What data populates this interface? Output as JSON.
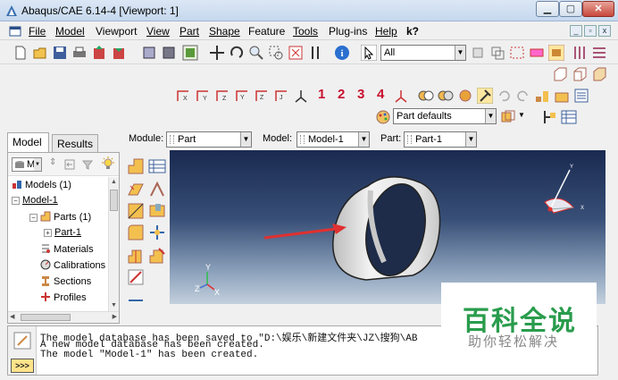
{
  "window": {
    "title": "Abaqus/CAE 6.14-4 [Viewport: 1]",
    "min_label": "▁",
    "max_label": "▢",
    "close_label": "✕"
  },
  "menu": {
    "items": [
      "File",
      "Model",
      "Viewport",
      "View",
      "Part",
      "Shape",
      "Feature",
      "Tools",
      "Plug-ins",
      "Help"
    ],
    "underline_index": [
      0,
      0,
      5,
      0,
      0,
      0,
      4,
      0,
      4,
      0
    ],
    "help_pointer": "k?"
  },
  "toolbar": {
    "selection_filter": "All",
    "view_numbers": [
      "1",
      "2",
      "3",
      "4"
    ],
    "part_defaults": "Part defaults"
  },
  "context": {
    "module_label": "Module:",
    "module_value": "Part",
    "model_label": "Model:",
    "model_value": "Model-1",
    "part_label": "Part:",
    "part_value": "Part-1"
  },
  "tabs": {
    "model": "Model",
    "results": "Results"
  },
  "tree": {
    "filter_value": "M",
    "nodes": [
      {
        "label": "Models (1)",
        "level": 0,
        "expander": ""
      },
      {
        "label": "Model-1",
        "level": 0,
        "expander": "−",
        "underline": true
      },
      {
        "label": "Parts (1)",
        "level": 1,
        "expander": "−"
      },
      {
        "label": "Part-1",
        "level": 2,
        "expander": "+",
        "underline": true
      },
      {
        "label": "Materials",
        "level": 1,
        "expander": ""
      },
      {
        "label": "Calibrations",
        "level": 1,
        "expander": ""
      },
      {
        "label": "Sections",
        "level": 1,
        "expander": ""
      },
      {
        "label": "Profiles",
        "level": 1,
        "expander": ""
      }
    ]
  },
  "viewport": {
    "triad_y": "Y",
    "triad_x": "X",
    "triad_z": "Z",
    "corner_x": "X",
    "corner_y": "Y"
  },
  "messages": [
    "The model database has been saved to \"D:\\娱乐\\新建文件夹\\JZ\\搜狗\\AB",
    "A new model database has been created.",
    "The model \"Model-1\" has been created."
  ],
  "prompt_button": ">>>",
  "watermark": {
    "title": "百科全说",
    "subtitle": "助你轻松解决"
  },
  "colors": {
    "accent_red": "#c8102e",
    "watermark_green": "#2a9c4d",
    "arrow_red": "#e03030"
  }
}
